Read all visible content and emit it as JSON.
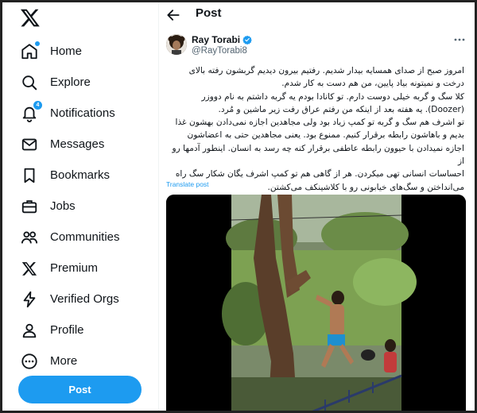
{
  "sidebar": {
    "logo_icon": "x-logo-icon",
    "items": [
      {
        "label": "Home",
        "icon": "home-icon"
      },
      {
        "label": "Explore",
        "icon": "search-icon"
      },
      {
        "label": "Notifications",
        "icon": "bell-icon",
        "badge": "4"
      },
      {
        "label": "Messages",
        "icon": "envelope-icon"
      },
      {
        "label": "Bookmarks",
        "icon": "bookmark-icon"
      },
      {
        "label": "Jobs",
        "icon": "briefcase-icon"
      },
      {
        "label": "Communities",
        "icon": "people-icon"
      },
      {
        "label": "Premium",
        "icon": "x-icon"
      },
      {
        "label": "Verified Orgs",
        "icon": "lightning-icon"
      },
      {
        "label": "Profile",
        "icon": "person-icon"
      },
      {
        "label": "More",
        "icon": "more-circle-icon"
      }
    ],
    "post_button": "Post"
  },
  "header": {
    "title": "Post"
  },
  "tweet": {
    "display_name": "Ray Torabi",
    "handle": "@RayTorabi8",
    "verified": true,
    "text_lines": [
      "امروز صبح از صدای همسایه بیدار شدیم. رفتیم بیرون دیدیم گربشون رفته بالای",
      "درخت و نمیتونه بیاد پایین، من هم دست به کار شدم.",
      "کلا سگ و گربه خیلی دوست دارم. تو کانادا بودم یه گربه داشتم به نام دووزر",
      "(Doozer). یه هفته بعد از اینکه من رفتم عراق رفت زیر ماشین و مُرد.",
      "تو اشرف هم سگ و گربه تو کمپ زیاد بود ولی مجاهدین اجازه نمی‌دادن بهشون غذا",
      "بدیم و باهاشون رابطه برقرار کنیم. ممنوع بود. یعنی مجاهدین حتی به اعضاشون",
      "اجازه نمیدادن با حیوون رابطه عاطفی برقرار کنه چه رسد به انسان. اینطور آدمها رو از",
      "احساسات انسانی تهی میکردن. هر از گاهی هم تو کمپ اشرف یگان شکار سگ راه",
      "می‌انداختن و سگ‌های خیابونی رو با کلاشینکف می‌کشتن."
    ],
    "translate_label": "Translate post",
    "media": "video-still"
  },
  "colors": {
    "accent": "#1d9bf0",
    "text": "#0f1419",
    "muted": "#536471"
  }
}
